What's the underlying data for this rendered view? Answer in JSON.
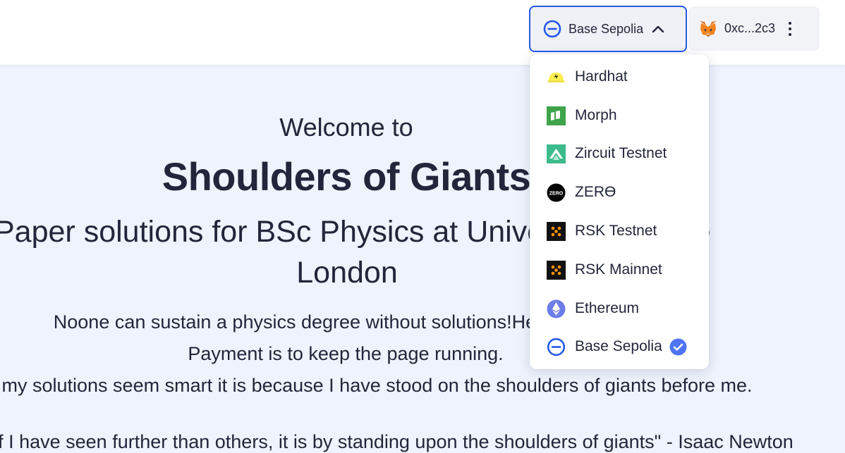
{
  "header": {
    "network_button": {
      "label": "Base Sepolia",
      "icon": "base-sepolia-icon",
      "expanded": true
    },
    "account": {
      "address": "0xc...2c3",
      "wallet_icon": "metamask-fox-icon"
    }
  },
  "network_menu": {
    "items": [
      {
        "label": "Hardhat",
        "icon": "hardhat-icon",
        "selected": false
      },
      {
        "label": "Morph",
        "icon": "morph-icon",
        "selected": false
      },
      {
        "label": "Zircuit Testnet",
        "icon": "zircuit-icon",
        "selected": false
      },
      {
        "label": "ZERϴ",
        "icon": "zero-icon",
        "selected": false
      },
      {
        "label": "RSK Testnet",
        "icon": "rsk-icon",
        "selected": false
      },
      {
        "label": "RSK Mainnet",
        "icon": "rsk-icon",
        "selected": false
      },
      {
        "label": "Ethereum",
        "icon": "ethereum-icon",
        "selected": false
      },
      {
        "label": "Base Sepolia",
        "icon": "base-sepolia-icon",
        "selected": true
      }
    ]
  },
  "hero": {
    "welcome": "Welcome to",
    "title": "Shoulders of Giants",
    "subtitle_line1": "Paper solutions for BSc Physics at University College",
    "subtitle_line2": "London",
    "para1": "Noone can sustain a physics degree without solutions!Here are mine.",
    "para2": "Payment is to keep the page running.",
    "para3": "If my solutions seem smart it is because I have stood on the shoulders of giants before me.",
    "para4": "\"If I have seen further than others, it is by standing upon the shoulders of giants\" - Isaac Newton"
  },
  "colors": {
    "accent": "#2659e8",
    "check": "#4f74f3",
    "background": "#eef3fd"
  }
}
